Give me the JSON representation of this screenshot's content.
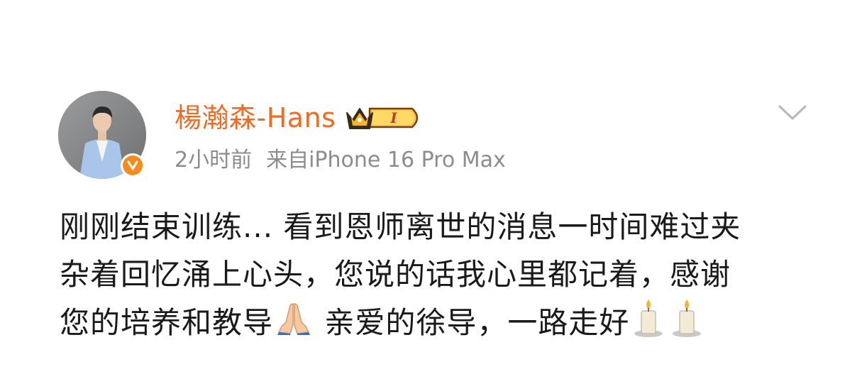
{
  "post": {
    "username": "楊瀚森-Hans",
    "vip_level": "I",
    "time": "2小时前",
    "source": "来自iPhone 16 Pro Max",
    "content_lines": [
      "刚刚结束训练... 看到恩师离世的消息一时间难过夹",
      "杂着回忆涌上心头，您说的话我心里都记着，感谢",
      "您的培养和教导",
      "亲爱的徐导，一路走好"
    ],
    "emojis": [
      "folded-hands",
      "candle",
      "candle"
    ]
  },
  "colors": {
    "username": "#f16a22",
    "meta": "#8c8c8c",
    "text": "#1a1a1a",
    "verified": "#f78b1e",
    "vip_gold": "#f5b62a"
  },
  "icons": {
    "verified": "verified-v-icon",
    "vip": "crown-vip-icon",
    "menu": "chevron-down-icon"
  }
}
